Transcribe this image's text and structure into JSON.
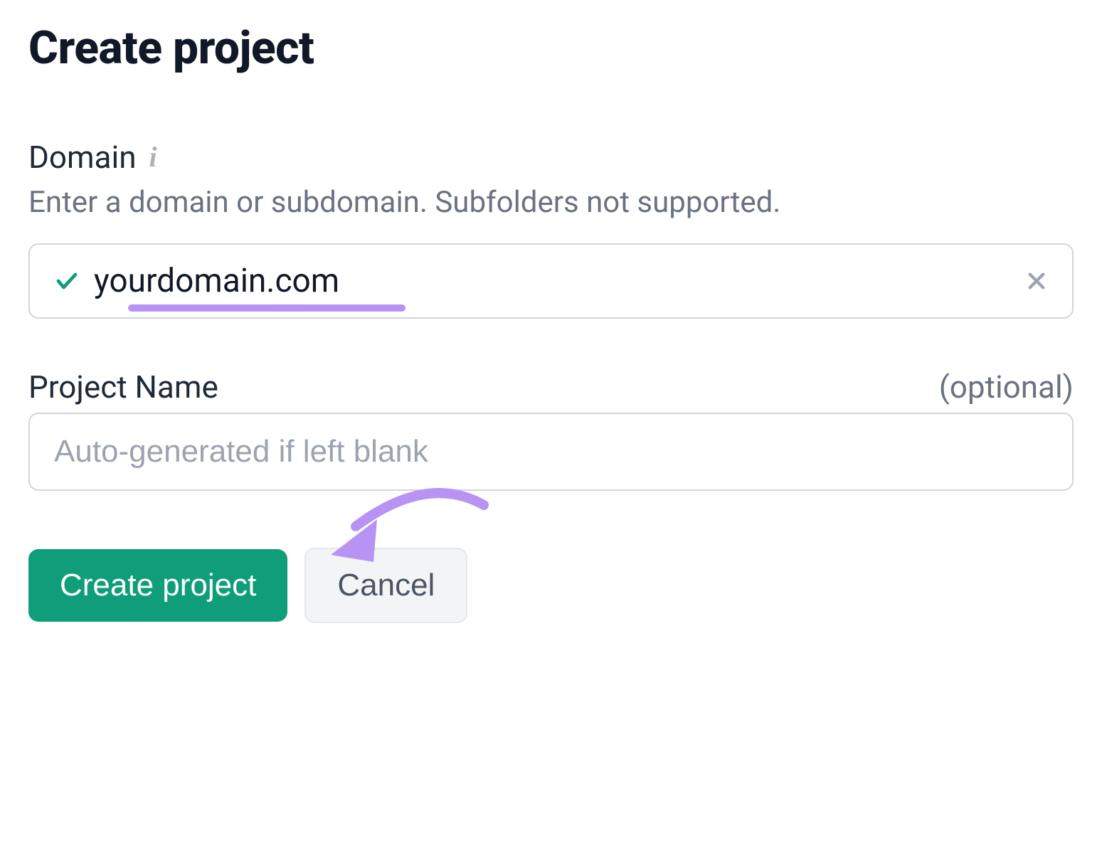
{
  "title": "Create project",
  "domain_field": {
    "label": "Domain",
    "hint": "Enter a domain or subdomain. Subfolders not supported.",
    "value": "yourdomain.com"
  },
  "project_name_field": {
    "label": "Project Name",
    "optional_tag": "(optional)",
    "placeholder": "Auto-generated if left blank",
    "value": ""
  },
  "buttons": {
    "create": "Create project",
    "cancel": "Cancel"
  }
}
